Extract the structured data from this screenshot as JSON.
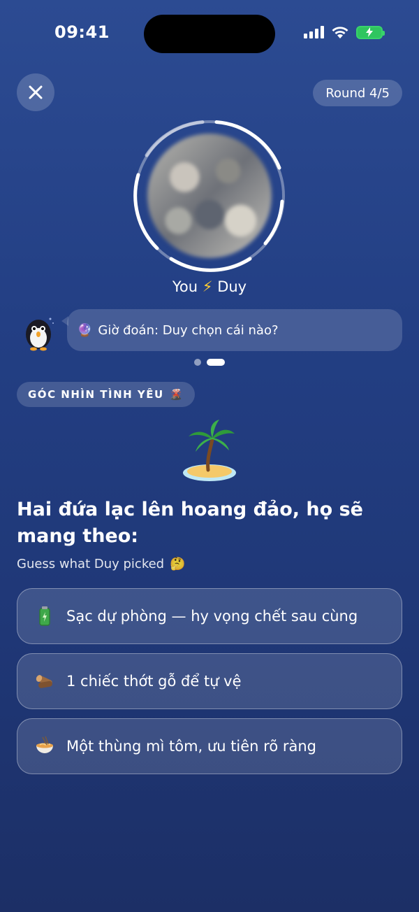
{
  "status_bar": {
    "time": "09:41"
  },
  "header": {
    "close_icon": "close-icon",
    "round_label": "Round 4/5"
  },
  "players": {
    "you": "You",
    "bolt": "⚡",
    "partner": "Duy"
  },
  "chat": {
    "emoji": "🔮",
    "message": "Giờ đoán: Duy chọn cái nào?"
  },
  "pagination": {
    "total": 2,
    "active": 2
  },
  "category": {
    "label": "GÓC NHÌN TÌNH YÊU",
    "emoji": "🌋"
  },
  "question": {
    "illustration": "desert-island-icon",
    "text": "Hai đứa lạc lên hoang đảo, họ sẽ mang theo:",
    "subtitle": "Guess what Duy picked",
    "subtitle_emoji": "🤔"
  },
  "options": [
    {
      "icon": "battery-icon",
      "label": "Sạc dự phòng — hy vọng chết sau cùng"
    },
    {
      "icon": "wood-icon",
      "label": "1 chiếc thớt gỗ để tự vệ"
    },
    {
      "icon": "noodle-bowl-icon",
      "label": "Một thùng mì tôm, ưu tiên rõ ràng"
    }
  ],
  "colors": {
    "background_top": "#2c4b92",
    "background_bottom": "#1c2f66",
    "battery_green": "#39d36b"
  }
}
